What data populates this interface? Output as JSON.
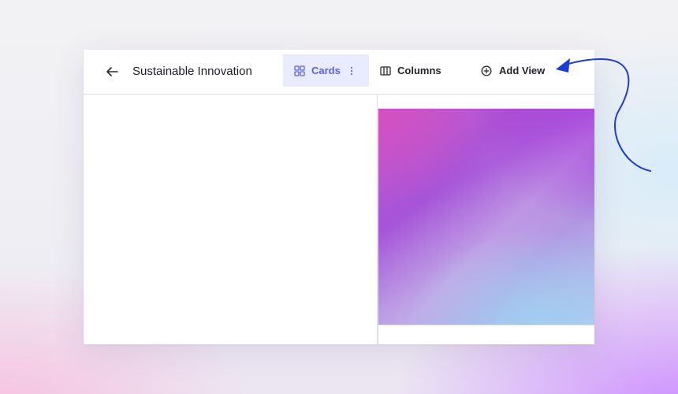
{
  "header": {
    "title": "Sustainable Innovation"
  },
  "views": {
    "tabs": [
      {
        "label": "Cards",
        "icon": "cards-grid-icon",
        "active": true
      },
      {
        "label": "Columns",
        "icon": "columns-icon",
        "active": false
      }
    ],
    "add_label": "Add View",
    "add_icon": "plus-circle-icon"
  },
  "colors": {
    "accent": "#5b62e8",
    "active_tab_bg": "#e9ebfe",
    "annotation_arrow": "#1e3bd6"
  }
}
